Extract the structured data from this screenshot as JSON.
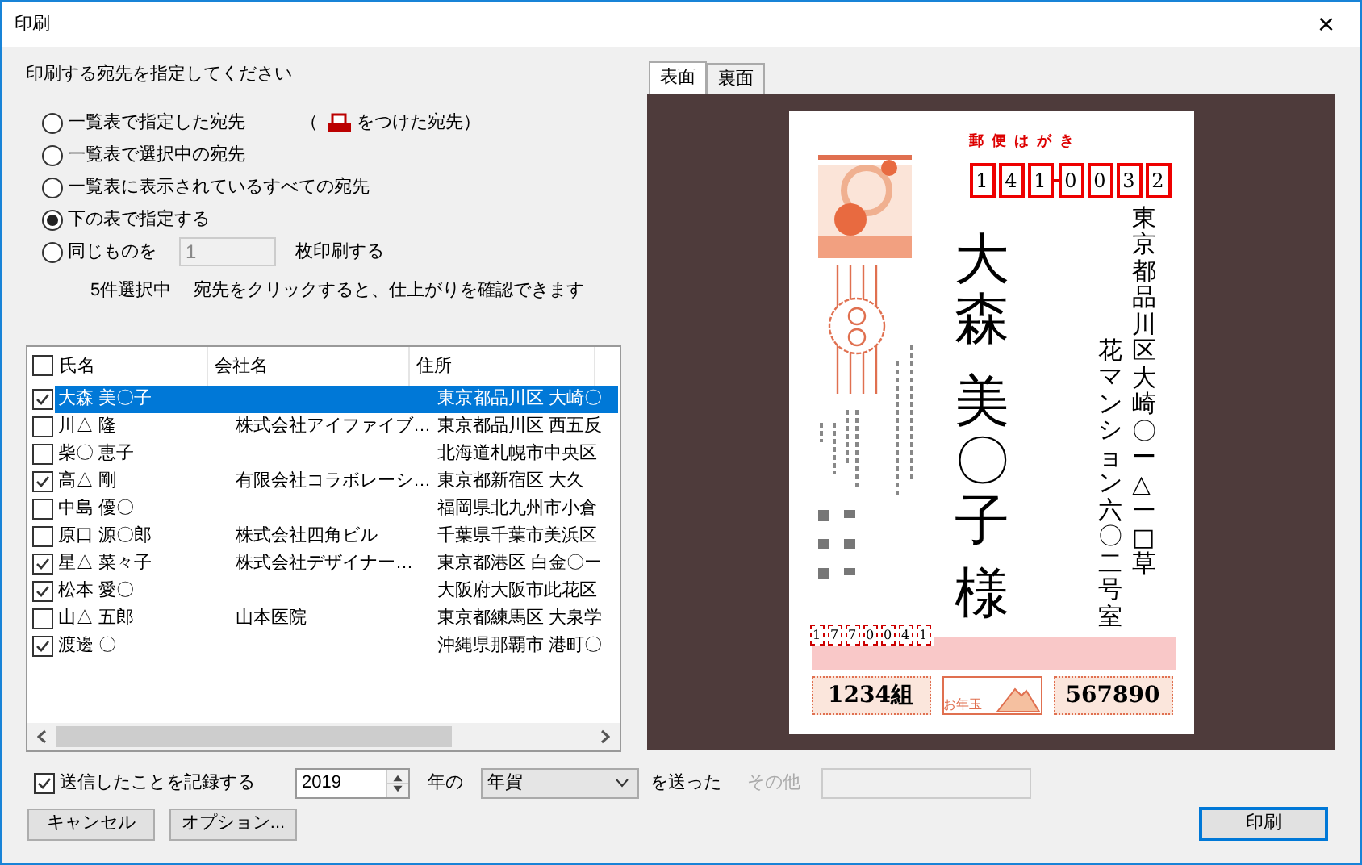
{
  "window": {
    "title": "印刷",
    "close": "×"
  },
  "target": {
    "heading": "印刷する宛先を指定してください",
    "options": [
      {
        "label": "一覧表で指定した宛先",
        "selected": false,
        "kind": "marked",
        "note_open": "（",
        "note_close": "をつけた宛先）"
      },
      {
        "label": "一覧表で選択中の宛先",
        "selected": false,
        "kind": "plain"
      },
      {
        "label": "一覧表に表示されているすべての宛先",
        "selected": false,
        "kind": "plain"
      },
      {
        "label": "下の表で指定する",
        "selected": true,
        "kind": "plain"
      },
      {
        "label": "同じものを",
        "selected": false,
        "kind": "copies",
        "value": "1",
        "suffix": "枚印刷する"
      }
    ],
    "count": "5件選択中",
    "hint": "宛先をクリックすると、仕上がりを確認できます"
  },
  "table": {
    "header_checked": false,
    "columns": [
      "氏名",
      "会社名",
      "住所"
    ],
    "rows": [
      {
        "checked": true,
        "selected": true,
        "cells": [
          "大森 美〇子",
          "",
          "東京都品川区 大崎〇"
        ]
      },
      {
        "checked": false,
        "selected": false,
        "cells": [
          "川△ 隆",
          "株式会社アイファイブ…",
          "東京都品川区 西五反"
        ]
      },
      {
        "checked": false,
        "selected": false,
        "cells": [
          "柴〇 恵子",
          "",
          "北海道札幌市中央区"
        ]
      },
      {
        "checked": true,
        "selected": false,
        "cells": [
          "高△ 剛",
          "有限会社コラボレーシ…",
          "東京都新宿区 大久"
        ]
      },
      {
        "checked": false,
        "selected": false,
        "cells": [
          "中島 優〇",
          "",
          "福岡県北九州市小倉"
        ]
      },
      {
        "checked": false,
        "selected": false,
        "cells": [
          "原口 源〇郎",
          "株式会社四角ビル",
          "千葉県千葉市美浜区"
        ]
      },
      {
        "checked": true,
        "selected": false,
        "cells": [
          "星△ 菜々子",
          "株式会社デザイナー…",
          "東京都港区 白金〇ー"
        ]
      },
      {
        "checked": true,
        "selected": false,
        "cells": [
          "松本 愛〇",
          "",
          "大阪府大阪市此花区"
        ]
      },
      {
        "checked": false,
        "selected": false,
        "cells": [
          "山△ 五郎",
          "山本医院",
          "東京都練馬区 大泉学"
        ]
      },
      {
        "checked": true,
        "selected": false,
        "cells": [
          "渡邊 〇",
          "",
          "沖縄県那覇市 港町〇"
        ]
      }
    ]
  },
  "record": {
    "checked": true,
    "label": "送信したことを記録する",
    "year": "2019",
    "year_suffix": "年の",
    "type": "年賀",
    "sent": "を送った",
    "other_label": "その他",
    "other_disabled": true
  },
  "buttons": {
    "cancel": "キャンセル",
    "options": "オプション...",
    "print": "印刷"
  },
  "preview": {
    "tabs": [
      {
        "label": "表面",
        "selected": true
      },
      {
        "label": "裏面",
        "selected": false
      }
    ],
    "card": {
      "header": "郵便はがき",
      "zip": [
        "1",
        "4",
        "1",
        "0",
        "0",
        "3",
        "2"
      ],
      "address_lines": [
        "東京都品川区大崎〇ー△ー□草",
        "花マンション六〇二号室"
      ],
      "family_name": "大森",
      "given_name": "美〇子",
      "honorific": "様",
      "sender_zip": [
        "1",
        "7",
        "7",
        "0",
        "0",
        "4",
        "1"
      ],
      "lottery_group": "1234組",
      "lottery_label": "お年玉",
      "lottery_number": "567890"
    }
  }
}
